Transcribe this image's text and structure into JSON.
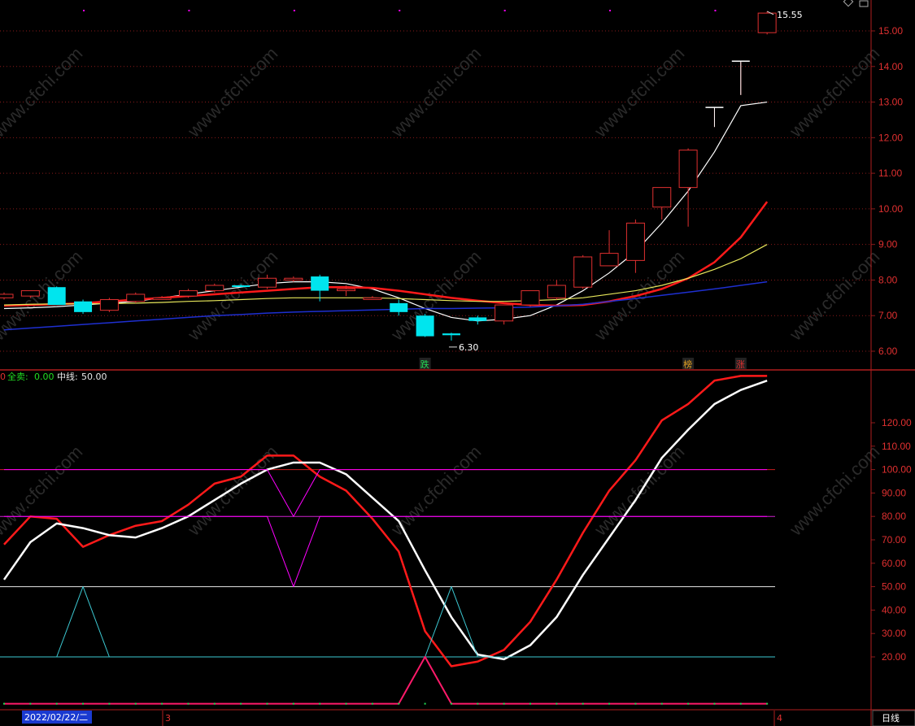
{
  "top_icons": [
    "diamond-icon",
    "lock-icon"
  ],
  "watermark": "www.cfchi.com",
  "period_button": "日线",
  "bottom_axis": {
    "date_label": "2022/02/22/二",
    "month_labels": [
      "3",
      "4"
    ]
  },
  "indicator_legend": {
    "prefix": "0",
    "full_sell_label": "全卖:",
    "full_sell_value": "0.00",
    "midline_label": "中线:",
    "midline_value": "50.00"
  },
  "price_annotations": {
    "high": "15.55",
    "low": "6.30"
  },
  "signals": [
    {
      "text": "跌",
      "candle": 16,
      "color": "#22dd55"
    },
    {
      "text": "榜",
      "candle": 26,
      "color": "#e0a020"
    },
    {
      "text": "涨",
      "candle": 28,
      "color": "#e03030"
    }
  ],
  "colors": {
    "up": "#e03030",
    "down": "#00e5ee",
    "ma_white": "#ffffff",
    "ma_red": "#ff1a1a",
    "ma_yellow": "#e6e65a",
    "ma_blue": "#1e2fd0",
    "magenta": "#ff00ff",
    "cyan": "#3cc8d2",
    "grid": "#8a1a1a"
  },
  "chart_data": [
    {
      "type": "candlestick",
      "title": "",
      "ylim": [
        5.7,
        16.0
      ],
      "yticks": [
        6.0,
        7.0,
        8.0,
        9.0,
        10.0,
        11.0,
        12.0,
        13.0,
        14.0,
        15.0
      ],
      "candles": [
        {
          "o": 7.5,
          "h": 7.65,
          "l": 7.45,
          "c": 7.6
        },
        {
          "o": 7.55,
          "h": 7.7,
          "l": 7.5,
          "c": 7.7
        },
        {
          "o": 7.8,
          "h": 7.82,
          "l": 7.3,
          "c": 7.3
        },
        {
          "o": 7.4,
          "h": 7.45,
          "l": 7.05,
          "c": 7.1
        },
        {
          "o": 7.15,
          "h": 7.5,
          "l": 7.1,
          "c": 7.45
        },
        {
          "o": 7.4,
          "h": 7.65,
          "l": 7.35,
          "c": 7.6
        },
        {
          "o": 7.5,
          "h": 7.55,
          "l": 7.45,
          "c": 7.5
        },
        {
          "o": 7.55,
          "h": 7.75,
          "l": 7.5,
          "c": 7.7
        },
        {
          "o": 7.7,
          "h": 7.9,
          "l": 7.65,
          "c": 7.85
        },
        {
          "o": 7.85,
          "h": 7.88,
          "l": 7.8,
          "c": 7.82
        },
        {
          "o": 7.8,
          "h": 8.15,
          "l": 7.75,
          "c": 8.05
        },
        {
          "o": 8.0,
          "h": 8.1,
          "l": 7.95,
          "c": 8.05
        },
        {
          "o": 8.1,
          "h": 8.15,
          "l": 7.4,
          "c": 7.7
        },
        {
          "o": 7.7,
          "h": 7.85,
          "l": 7.55,
          "c": 7.75
        },
        {
          "o": 7.5,
          "h": 7.55,
          "l": 7.45,
          "c": 7.5
        },
        {
          "o": 7.35,
          "h": 7.45,
          "l": 7.0,
          "c": 7.1
        },
        {
          "o": 7.0,
          "h": 7.05,
          "l": 6.4,
          "c": 6.42
        },
        {
          "o": 6.5,
          "h": 6.52,
          "l": 6.3,
          "c": 6.45
        },
        {
          "o": 6.95,
          "h": 7.0,
          "l": 6.75,
          "c": 6.85
        },
        {
          "o": 6.85,
          "h": 7.3,
          "l": 6.75,
          "c": 7.3
        },
        {
          "o": 7.3,
          "h": 7.7,
          "l": 7.25,
          "c": 7.7
        },
        {
          "o": 7.5,
          "h": 8.0,
          "l": 7.45,
          "c": 7.85
        },
        {
          "o": 7.8,
          "h": 8.7,
          "l": 7.75,
          "c": 8.65
        },
        {
          "o": 8.4,
          "h": 9.4,
          "l": 8.4,
          "c": 8.75
        },
        {
          "o": 8.55,
          "h": 9.7,
          "l": 8.2,
          "c": 9.6
        },
        {
          "o": 10.05,
          "h": 10.6,
          "l": 9.7,
          "c": 10.6
        },
        {
          "o": 10.6,
          "h": 11.7,
          "l": 9.5,
          "c": 11.65
        },
        {
          "o": 12.85,
          "h": 12.85,
          "l": 12.3,
          "c": 12.85
        },
        {
          "o": 14.15,
          "h": 14.15,
          "l": 13.2,
          "c": 14.15
        },
        {
          "o": 14.95,
          "h": 15.55,
          "l": 14.9,
          "c": 15.5
        }
      ],
      "moving_averages": [
        {
          "color": "#ffffff",
          "width": 1.2,
          "values": [
            7.2,
            7.22,
            7.25,
            7.3,
            7.35,
            7.4,
            7.5,
            7.6,
            7.7,
            7.8,
            7.9,
            7.95,
            7.95,
            7.9,
            7.75,
            7.5,
            7.2,
            6.95,
            6.85,
            6.9,
            7.0,
            7.3,
            7.7,
            8.2,
            8.8,
            9.6,
            10.5,
            11.6,
            12.9,
            13.0
          ]
        },
        {
          "color": "#ff1a1a",
          "width": 2.5,
          "values": [
            7.28,
            7.3,
            7.32,
            7.35,
            7.4,
            7.45,
            7.5,
            7.55,
            7.6,
            7.65,
            7.7,
            7.75,
            7.8,
            7.8,
            7.78,
            7.7,
            7.6,
            7.5,
            7.42,
            7.35,
            7.3,
            7.28,
            7.3,
            7.4,
            7.55,
            7.75,
            8.05,
            8.5,
            9.2,
            10.2
          ]
        },
        {
          "color": "#e6e65a",
          "width": 1.2,
          "values": [
            7.3,
            7.32,
            7.33,
            7.33,
            7.34,
            7.35,
            7.37,
            7.4,
            7.42,
            7.45,
            7.48,
            7.5,
            7.5,
            7.5,
            7.5,
            7.48,
            7.45,
            7.42,
            7.4,
            7.4,
            7.42,
            7.45,
            7.5,
            7.6,
            7.7,
            7.85,
            8.05,
            8.3,
            8.6,
            9.0
          ]
        },
        {
          "color": "#1e2fd0",
          "width": 1.5,
          "values": [
            6.6,
            6.65,
            6.7,
            6.75,
            6.8,
            6.85,
            6.9,
            6.95,
            7.0,
            7.03,
            7.07,
            7.1,
            7.12,
            7.14,
            7.16,
            7.18,
            7.2,
            7.2,
            7.21,
            7.22,
            7.24,
            7.27,
            7.32,
            7.4,
            7.48,
            7.57,
            7.66,
            7.75,
            7.85,
            7.95
          ]
        }
      ]
    },
    {
      "type": "line",
      "title": "",
      "ylim": [
        0,
        135
      ],
      "yticks": [
        20,
        30,
        40,
        50,
        60,
        70,
        80,
        90,
        100,
        110,
        120
      ],
      "hlines": [
        {
          "y": 100,
          "color": "#c81e1e"
        },
        {
          "y": 80,
          "color": "#cc22cc"
        },
        {
          "y": 50,
          "color": "#e8e8e8"
        },
        {
          "y": 20,
          "color": "#3cc8d2"
        }
      ],
      "series": [
        {
          "color": "#ff1a1a",
          "width": 2.5,
          "values": [
            68,
            80,
            79,
            67,
            72,
            76,
            78,
            85,
            94,
            97,
            106,
            106,
            97,
            91,
            79,
            65,
            31,
            16,
            18,
            23,
            35,
            53,
            73,
            91,
            104,
            121,
            128,
            138,
            140,
            140
          ]
        },
        {
          "color": "#ffffff",
          "width": 2.5,
          "values": [
            53,
            69,
            77,
            75,
            72,
            71,
            75,
            80,
            87,
            94,
            100,
            103,
            103,
            98,
            88,
            78,
            57,
            37,
            21,
            19,
            25,
            37,
            55,
            71,
            87,
            105,
            117,
            128,
            134,
            138
          ]
        },
        {
          "color": "#ff00ff",
          "width": 1,
          "values": [
            100,
            100,
            100,
            100,
            100,
            100,
            100,
            100,
            100,
            100,
            100,
            80,
            100,
            100,
            100,
            100,
            100,
            100,
            100,
            100,
            100,
            100,
            100,
            100,
            100,
            100,
            100,
            100,
            100,
            100
          ]
        },
        {
          "color": "#ff00ff",
          "width": 1,
          "values": [
            80,
            80,
            80,
            80,
            80,
            80,
            80,
            80,
            80,
            80,
            80,
            50,
            80,
            80,
            80,
            80,
            80,
            80,
            80,
            80,
            80,
            80,
            80,
            80,
            80,
            80,
            80,
            80,
            80,
            80
          ]
        },
        {
          "color": "#3cc8d2",
          "width": 1,
          "values": [
            20,
            20,
            20,
            50,
            20,
            20,
            20,
            20,
            20,
            20,
            20,
            20,
            20,
            20,
            20,
            20,
            20,
            50,
            20,
            20,
            20,
            20,
            20,
            20,
            20,
            20,
            20,
            20,
            20,
            20
          ]
        },
        {
          "color": "#ff1a6a",
          "width": 2,
          "values": [
            0,
            0,
            0,
            0,
            0,
            0,
            0,
            0,
            0,
            0,
            0,
            0,
            0,
            0,
            0,
            0,
            20,
            0,
            0,
            0,
            0,
            0,
            0,
            0,
            0,
            0,
            0,
            0,
            0,
            0
          ]
        }
      ]
    }
  ]
}
